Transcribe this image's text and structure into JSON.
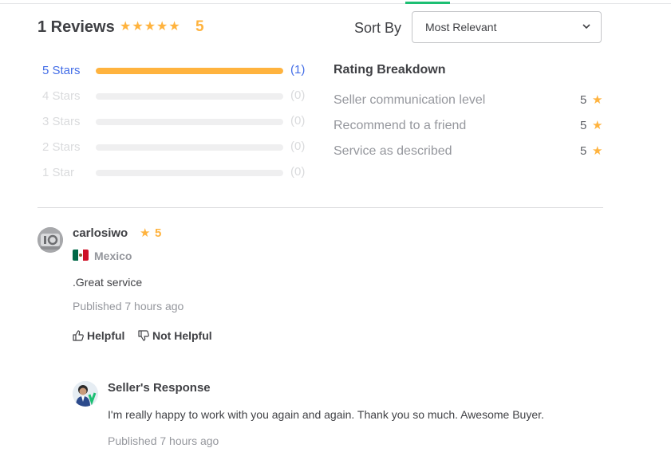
{
  "header": {
    "reviews_title": "1 Reviews",
    "overall_rating": "5",
    "overall_stars": 5,
    "sort_label": "Sort By",
    "sort_value": "Most Relevant"
  },
  "star_bars": [
    {
      "label": "5 Stars",
      "count": "(1)",
      "fill": 1.0,
      "active": true
    },
    {
      "label": "4 Stars",
      "count": "(0)",
      "fill": 0,
      "active": false
    },
    {
      "label": "3 Stars",
      "count": "(0)",
      "fill": 0,
      "active": false
    },
    {
      "label": "2 Stars",
      "count": "(0)",
      "fill": 0,
      "active": false
    },
    {
      "label": "1 Star",
      "count": "(0)",
      "fill": 0,
      "active": false
    }
  ],
  "breakdown": {
    "title": "Rating Breakdown",
    "items": [
      {
        "label": "Seller communication level",
        "value": "5"
      },
      {
        "label": "Recommend to a friend",
        "value": "5"
      },
      {
        "label": "Service as described",
        "value": "5"
      }
    ]
  },
  "review": {
    "username": "carlosiwo",
    "rating": "5",
    "country": "Mexico",
    "text": ".Great service",
    "published": "Published 7 hours ago",
    "helpful_label": "Helpful",
    "not_helpful_label": "Not Helpful"
  },
  "seller_response": {
    "title": "Seller's Response",
    "text": "I'm really happy to work with you again and again. Thank you so much. Awesome Buyer.",
    "published": "Published 7 hours ago"
  },
  "colors": {
    "star": "#ffb33e",
    "active_link": "#446ee7",
    "accent": "#1dbf73"
  }
}
